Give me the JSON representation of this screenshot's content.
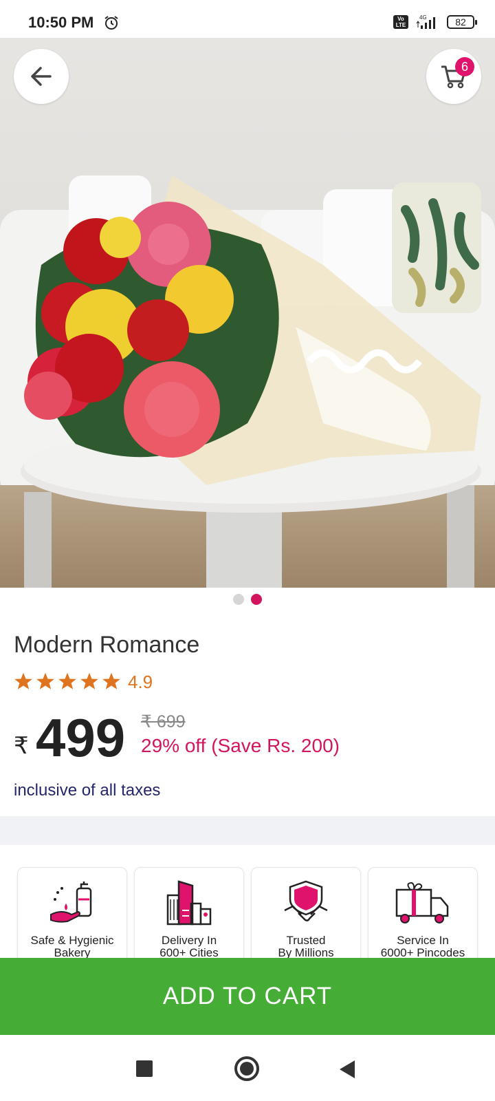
{
  "status_bar": {
    "time": "10:50 PM",
    "volte_label": "Vo LTE",
    "network_label": "4G",
    "battery_level": "82"
  },
  "header": {
    "cart_count": "6"
  },
  "carousel": {
    "total_slides": 2,
    "active_slide": 2
  },
  "product": {
    "name": "Modern Romance",
    "rating": "4.9",
    "stars": 5,
    "currency_symbol": "₹",
    "price": "499",
    "mrp": "₹ 699",
    "discount_text": "29% off (Save Rs. 200)",
    "tax_note": "inclusive of all taxes"
  },
  "features": [
    {
      "label": "Safe & Hygienic\nBakery",
      "icon": "hand-sanitizer-icon"
    },
    {
      "label": "Delivery In\n600+ Cities",
      "icon": "city-buildings-icon"
    },
    {
      "label": "Trusted\nBy Millions",
      "icon": "shield-handshake-icon"
    },
    {
      "label": "Service In\n6000+ Pincodes",
      "icon": "delivery-truck-icon"
    }
  ],
  "actions": {
    "add_to_cart_label": "ADD TO CART"
  },
  "colors": {
    "accent": "#d3155f",
    "cta_green": "#45ad35",
    "star": "#e0731d",
    "tax_text": "#23266b"
  }
}
